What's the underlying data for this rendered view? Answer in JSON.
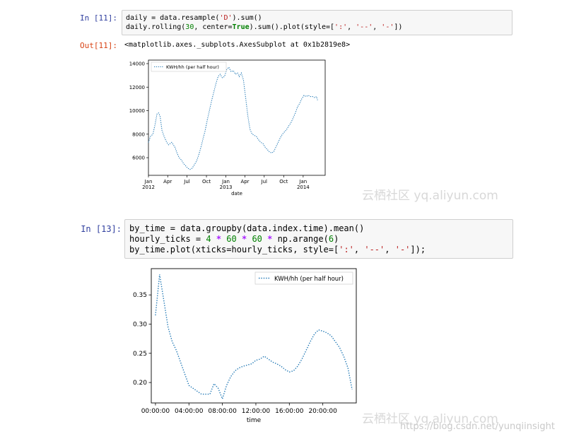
{
  "cell11": {
    "prompt_in": "In [11]:",
    "prompt_out": "Out[11]:",
    "code_line1_a": "daily = data.resample(",
    "code_line1_str": "'D'",
    "code_line1_b": ").sum()",
    "code_line2_a": "daily.rolling(",
    "code_line2_num": "30",
    "code_line2_b": ", center=",
    "code_line2_kw": "True",
    "code_line2_c": ").sum().plot(style=[",
    "code_line2_s1": "':'",
    "code_line2_sep1": ", ",
    "code_line2_s2": "'--'",
    "code_line2_sep2": ", ",
    "code_line2_s3": "'-'",
    "code_line2_d": "])",
    "output": "<matplotlib.axes._subplots.AxesSubplot at 0x1b2819e8>"
  },
  "cell13": {
    "prompt_in": "In [13]:",
    "line1": "by_time = data.groupby(data.index.time).mean()",
    "line2_a": "hourly_ticks = ",
    "line2_n1": "4",
    "line2_op1": " * ",
    "line2_n2": "60",
    "line2_op2": " * ",
    "line2_n3": "60",
    "line2_op3": " * ",
    "line2_b": "np.arange(",
    "line2_n4": "6",
    "line2_c": ")",
    "line3_a": "by_time.plot(xticks=hourly_ticks, style=[",
    "line3_s1": "':'",
    "line3_sep1": ", ",
    "line3_s2": "'--'",
    "line3_sep2": ", ",
    "line3_s3": "'-'",
    "line3_b": "]);"
  },
  "watermark1": "云栖社区 yq.aliyun.com",
  "watermark2": "云栖社区 yq.aliyun.com",
  "watermark3": "https://blog.csdn.net/yunqiinsight",
  "chart_data": [
    {
      "type": "line",
      "title": "",
      "xlabel": "date",
      "ylabel": "",
      "legend": [
        "KWH/hh (per half hour)"
      ],
      "legend_position": "top-left",
      "line_style": "dotted",
      "color": "#1f77b4",
      "ylim": [
        4500,
        14300
      ],
      "yticks": [
        6000,
        8000,
        10000,
        12000,
        14000
      ],
      "xlim": [
        "2012-01-01",
        "2014-04-15"
      ],
      "xticks": [
        {
          "x": "2012-01-01",
          "label": "Jan",
          "sub": "2012"
        },
        {
          "x": "2012-04-01",
          "label": "Apr",
          "sub": ""
        },
        {
          "x": "2012-07-01",
          "label": "Jul",
          "sub": ""
        },
        {
          "x": "2012-10-01",
          "label": "Oct",
          "sub": ""
        },
        {
          "x": "2013-01-01",
          "label": "Jan",
          "sub": "2013"
        },
        {
          "x": "2013-04-01",
          "label": "Apr",
          "sub": ""
        },
        {
          "x": "2013-07-01",
          "label": "Jul",
          "sub": ""
        },
        {
          "x": "2013-10-01",
          "label": "Oct",
          "sub": ""
        },
        {
          "x": "2014-01-01",
          "label": "Jan",
          "sub": "2014"
        }
      ],
      "series": [
        {
          "name": "KWH/hh (per half hour)",
          "x": [
            "2012-01-01",
            "2012-01-10",
            "2012-01-22",
            "2012-02-01",
            "2012-02-10",
            "2012-02-18",
            "2012-02-25",
            "2012-03-05",
            "2012-03-15",
            "2012-03-25",
            "2012-04-05",
            "2012-04-20",
            "2012-05-05",
            "2012-05-15",
            "2012-05-25",
            "2012-06-05",
            "2012-06-15",
            "2012-06-25",
            "2012-07-05",
            "2012-07-15",
            "2012-07-25",
            "2012-08-05",
            "2012-08-15",
            "2012-08-25",
            "2012-09-05",
            "2012-09-15",
            "2012-09-25",
            "2012-10-05",
            "2012-10-15",
            "2012-10-25",
            "2012-11-05",
            "2012-11-15",
            "2012-11-25",
            "2012-12-05",
            "2012-12-15",
            "2012-12-25",
            "2013-01-05",
            "2013-01-15",
            "2013-01-25",
            "2013-02-05",
            "2013-02-15",
            "2013-02-25",
            "2013-03-05",
            "2013-03-15",
            "2013-03-25",
            "2013-04-05",
            "2013-04-15",
            "2013-04-25",
            "2013-05-05",
            "2013-05-15",
            "2013-05-25",
            "2013-06-05",
            "2013-06-15",
            "2013-06-25",
            "2013-07-05",
            "2013-07-15",
            "2013-07-25",
            "2013-08-05",
            "2013-08-15",
            "2013-08-25",
            "2013-09-05",
            "2013-09-15",
            "2013-09-25",
            "2013-10-05",
            "2013-10-15",
            "2013-10-25",
            "2013-11-05",
            "2013-11-15",
            "2013-11-25",
            "2013-12-05",
            "2013-12-15",
            "2013-12-25",
            "2014-01-05",
            "2014-01-15",
            "2014-01-25",
            "2014-02-05",
            "2014-02-15",
            "2014-02-25",
            "2014-03-05",
            "2014-03-10"
          ],
          "values": [
            7300,
            7800,
            8000,
            8800,
            9700,
            9800,
            9500,
            8300,
            7800,
            7400,
            7100,
            7300,
            6900,
            6400,
            6000,
            5800,
            5500,
            5300,
            5100,
            5000,
            5100,
            5400,
            5700,
            6200,
            6900,
            7600,
            8300,
            9200,
            10000,
            10800,
            11600,
            12300,
            12900,
            13100,
            12800,
            12900,
            13500,
            13700,
            13300,
            13400,
            13100,
            13200,
            12900,
            13200,
            12600,
            11000,
            9500,
            8400,
            8000,
            7900,
            7800,
            7500,
            7300,
            7200,
            6900,
            6700,
            6500,
            6400,
            6500,
            6900,
            7300,
            7700,
            8000,
            8200,
            8400,
            8700,
            9000,
            9400,
            9800,
            10300,
            10600,
            11000,
            11300,
            11200,
            11300,
            11200,
            11200,
            11100,
            11200,
            10900
          ]
        }
      ]
    },
    {
      "type": "line",
      "title": "",
      "xlabel": "time",
      "ylabel": "",
      "legend": [
        "KWH/hh (per half hour)"
      ],
      "legend_position": "top-right",
      "line_style": "dotted",
      "color": "#1f77b4",
      "ylim": [
        0.165,
        0.395
      ],
      "yticks": [
        0.2,
        0.25,
        0.3,
        0.35
      ],
      "ytick_labels": [
        "0.20",
        "0.25",
        "0.30",
        "0.35"
      ],
      "xlim": [
        -0.5,
        24
      ],
      "xticks": [
        {
          "x": 0,
          "label": "00:00:00"
        },
        {
          "x": 4,
          "label": "04:00:00"
        },
        {
          "x": 8,
          "label": "08:00:00"
        },
        {
          "x": 12,
          "label": "12:00:00"
        },
        {
          "x": 16,
          "label": "16:00:00"
        },
        {
          "x": 20,
          "label": "20:00:00"
        }
      ],
      "series": [
        {
          "name": "KWH/hh (per half hour)",
          "x": [
            0,
            0.5,
            1,
            1.5,
            2,
            2.5,
            3,
            3.5,
            4,
            4.5,
            5,
            5.5,
            6,
            6.5,
            7,
            7.5,
            8,
            8.5,
            9,
            9.5,
            10,
            10.5,
            11,
            11.5,
            12,
            12.5,
            13,
            13.5,
            14,
            14.5,
            15,
            15.5,
            16,
            16.5,
            17,
            17.5,
            18,
            18.5,
            19,
            19.5,
            20,
            20.5,
            21,
            21.5,
            22,
            22.5,
            23,
            23.5
          ],
          "values": [
            0.315,
            0.385,
            0.34,
            0.295,
            0.27,
            0.255,
            0.235,
            0.215,
            0.195,
            0.19,
            0.185,
            0.18,
            0.18,
            0.18,
            0.198,
            0.19,
            0.172,
            0.195,
            0.21,
            0.22,
            0.225,
            0.228,
            0.23,
            0.232,
            0.238,
            0.24,
            0.245,
            0.24,
            0.235,
            0.232,
            0.228,
            0.222,
            0.218,
            0.22,
            0.228,
            0.24,
            0.255,
            0.27,
            0.283,
            0.29,
            0.288,
            0.285,
            0.28,
            0.27,
            0.26,
            0.245,
            0.225,
            0.188
          ]
        }
      ]
    }
  ]
}
